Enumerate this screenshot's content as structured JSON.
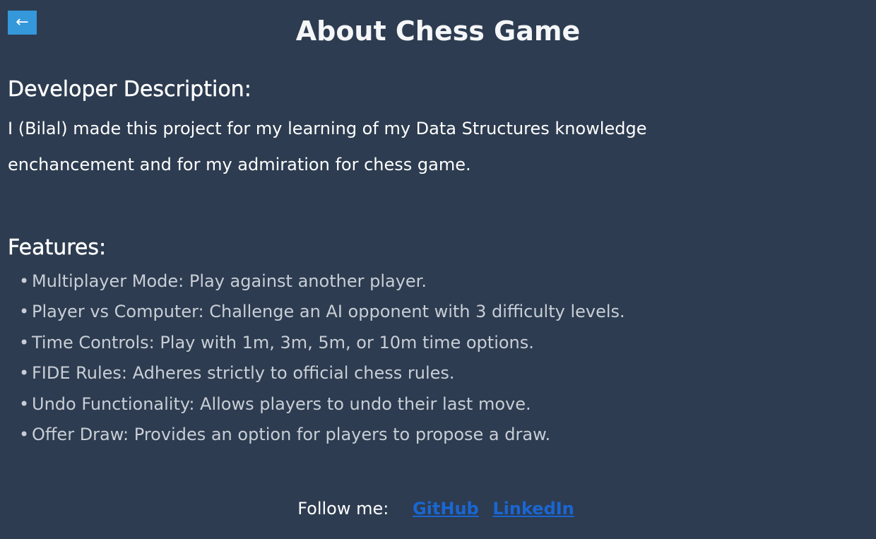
{
  "header": {
    "back_label": "←",
    "title": "About Chess Game"
  },
  "developer": {
    "heading": "Developer Description:",
    "description": "I (Bilal) made this project for my learning of my Data Structures knowledge enchancement and for my admiration for chess game."
  },
  "features": {
    "heading": "Features:",
    "bullet": "•",
    "items": [
      "Multiplayer Mode: Play against another player.",
      "Player vs Computer: Challenge an AI opponent with 3 difficulty levels.",
      "Time Controls: Play with 1m, 3m, 5m, or 10m time options.",
      "FIDE Rules: Adheres strictly to official chess rules.",
      "Undo Functionality: Allows players to undo their last move.",
      "Offer Draw: Provides an option for players to propose a draw."
    ]
  },
  "footer": {
    "label": "Follow me:",
    "github": "GitHub",
    "linkedin": "LinkedIn"
  },
  "colors": {
    "background": "#2d3c50",
    "back_button": "#3498db",
    "link": "#1a66d2",
    "feature_text": "#c8ced6"
  }
}
